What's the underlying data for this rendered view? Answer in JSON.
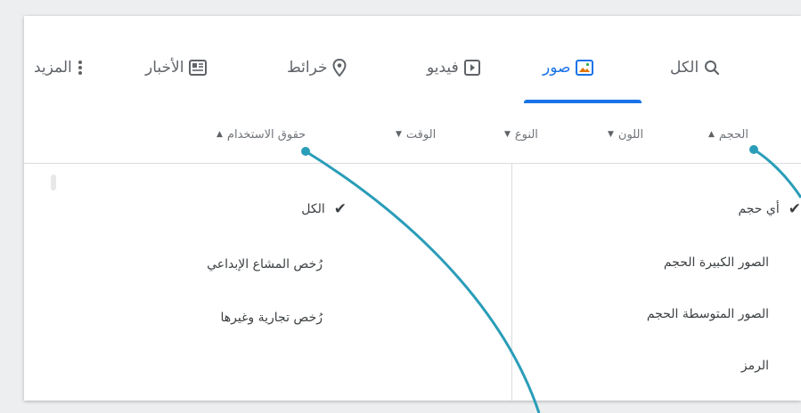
{
  "tabs": [
    {
      "label": "الكل",
      "icon": "search-icon"
    },
    {
      "label": "صور",
      "icon": "image-icon",
      "active": true
    },
    {
      "label": "فيديو",
      "icon": "play-icon"
    },
    {
      "label": "خرائط",
      "icon": "map-pin-icon"
    },
    {
      "label": "الأخبار",
      "icon": "newspaper-icon"
    },
    {
      "label": "المزيد",
      "icon": "more-vert-icon"
    }
  ],
  "filters": [
    {
      "label": "الحجم",
      "arrow": "▲"
    },
    {
      "label": "اللون",
      "arrow": "▼"
    },
    {
      "label": "النوع",
      "arrow": "▼"
    },
    {
      "label": "الوقت",
      "arrow": "▼"
    },
    {
      "label": "حقوق الاستخدام",
      "arrow": "▲"
    }
  ],
  "size_menu": {
    "check": "✔",
    "options": [
      "أي حجم",
      "الصور الكبيرة الحجم",
      "الصور المتوسطة الحجم",
      "الرمز"
    ]
  },
  "rights_menu": {
    "check": "✔",
    "options": [
      "الكل",
      "رُخص المشاع الإبداعي",
      "رُخص تجارية وغيرها"
    ]
  },
  "colors": {
    "accent": "#1a73e8",
    "callout": "#2a9db8"
  }
}
